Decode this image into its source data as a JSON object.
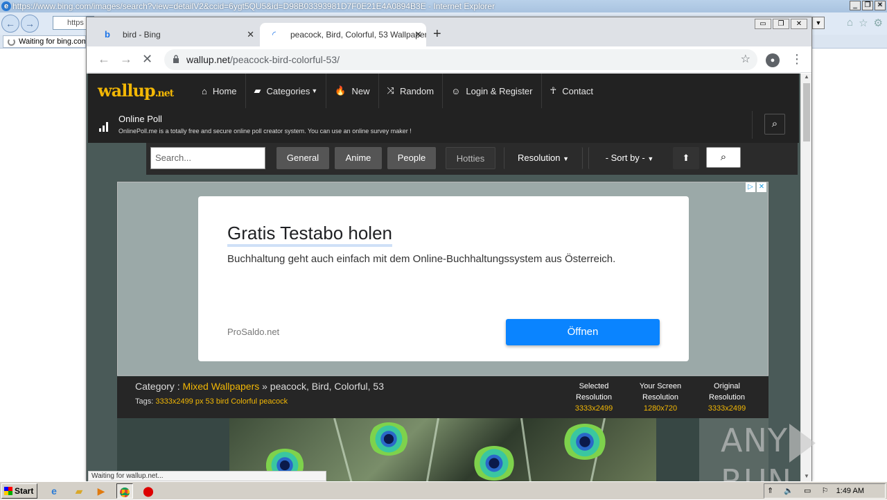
{
  "ie": {
    "title": "https://www.bing.com/images/search?view=detailV2&ccid=6ygt5QU5&id=D98B03393981D7F0E21E4A0894B3E - Internet Explorer",
    "address": "https",
    "tab_label": "Waiting for bing.com"
  },
  "chrome": {
    "tabs": [
      {
        "label": "bird - Bing"
      },
      {
        "label": "peacock, Bird, Colorful, 53 Wallpaper"
      }
    ],
    "url_host": "wallup.net",
    "url_path": "/peacock-bird-colorful-53/",
    "status": "Waiting for wallup.net..."
  },
  "site": {
    "logo": "wallup",
    "logo_suffix": ".net",
    "menu": [
      "Home",
      "Categories",
      "New",
      "Random",
      "Login & Register",
      "Contact"
    ],
    "poll_title": "Online Poll",
    "poll_desc": "OnlinePoll.me is a totally free and secure online poll creator system. You can use an online survey maker !",
    "search_placeholder": "Search...",
    "filters": [
      "General",
      "Anime",
      "People",
      "Hotties",
      "Resolution",
      "- Sort by -"
    ],
    "category_label": "Category :",
    "category_link": "Mixed Wallpapers",
    "category_rest": "» peacock, Bird, Colorful, 53",
    "tags_label": "Tags:",
    "tags": "3333x2499 px 53 bird Colorful peacock",
    "res": [
      {
        "l1": "Selected",
        "l2": "Resolution",
        "v": "3333x2499"
      },
      {
        "l1": "Your Screen",
        "l2": "Resolution",
        "v": "1280x720"
      },
      {
        "l1": "Original",
        "l2": "Resolution",
        "v": "3333x2499"
      }
    ]
  },
  "ad": {
    "headline": "Gratis Testabo holen",
    "body": "Buchhaltung geht auch einfach mit dem Online-Buchhaltungssystem aus Österreich.",
    "source": "ProSaldo.net",
    "cta": "Öffnen"
  },
  "watermark": {
    "left": "ANY",
    "right": "RUN"
  },
  "taskbar": {
    "start": "Start",
    "time": "1:49 AM"
  }
}
